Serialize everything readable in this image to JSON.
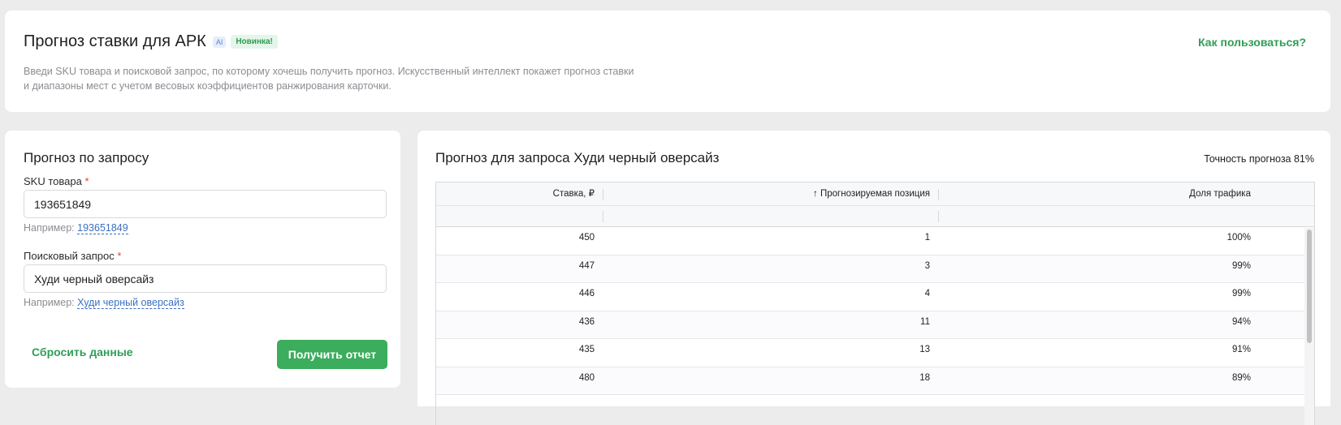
{
  "header": {
    "title": "Прогноз ставки для АРК",
    "ai_badge": "AI",
    "new_badge": "Новинка!",
    "help_link": "Как пользоваться?",
    "description": "Введи SKU товара и поисковой запрос, по которому хочешь получить прогноз. Искусственный интеллект покажет прогноз ставки и диапазоны мест с учетом весовых коэффициентов ранжирования карточки."
  },
  "form": {
    "title": "Прогноз по запросу",
    "sku_label": "SKU товара",
    "required_mark": "*",
    "sku_value": "193651849",
    "sku_example_prefix": "Например:",
    "sku_example_value": "193651849",
    "query_label": "Поисковый запрос",
    "query_value": "Худи черный оверсайз",
    "query_example_prefix": "Например:",
    "query_example_value": "Худи черный оверсайз",
    "reset_label": "Сбросить данные",
    "submit_label": "Получить отчет"
  },
  "results": {
    "title": "Прогноз для запроса Худи черный оверсайз",
    "accuracy": "Точность прогноза 81%",
    "columns": [
      "Ставка, ₽",
      "Прогнозируемая позиция",
      "Доля трафика"
    ],
    "sort_indicator": "↑",
    "rows": [
      [
        "450",
        "1",
        "100%"
      ],
      [
        "447",
        "3",
        "99%"
      ],
      [
        "446",
        "4",
        "99%"
      ],
      [
        "436",
        "11",
        "94%"
      ],
      [
        "435",
        "13",
        "91%"
      ],
      [
        "480",
        "18",
        "89%"
      ]
    ]
  },
  "colors": {
    "accent_green": "#3bad5c",
    "link_green": "#2f9e57",
    "link_blue": "#3b6fc2",
    "required_red": "#e0443c"
  }
}
